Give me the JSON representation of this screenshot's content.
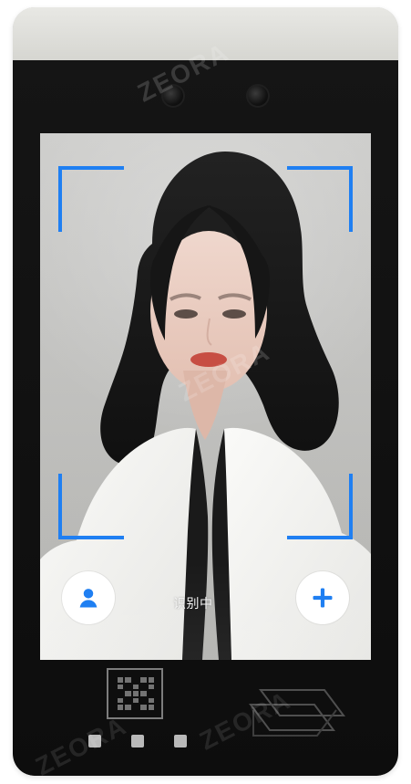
{
  "screen": {
    "status_text": "识别中"
  },
  "watermarks": [
    "ZEORA",
    "ZEORA",
    "ZEORA",
    "ZEORA"
  ],
  "colors": {
    "frame_blue": "#1f7ff2",
    "device_black": "#111111",
    "device_top": "#dcdcd8",
    "screen_bg": "#c3c3c0",
    "jacket_white": "#f2f2f0",
    "inner_black": "#1a1a1a",
    "hair_dark": "#1a1a1a",
    "skin": "#e8c7bb",
    "lip_red": "#c74e43"
  },
  "icons": {
    "user": "user-icon",
    "plus": "plus-icon",
    "qr": "qr-icon",
    "card": "card-reader-icon",
    "camera": "camera-icon"
  }
}
